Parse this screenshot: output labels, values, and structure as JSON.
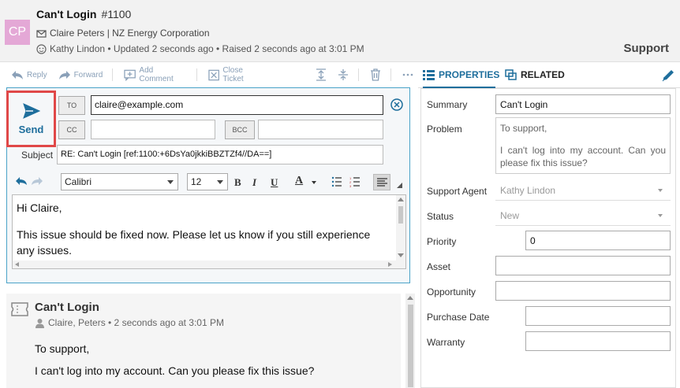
{
  "header": {
    "avatar_initials": "CP",
    "title": "Can't Login",
    "ticket_number": "#1100",
    "contact": "Claire Peters | NZ Energy Corporation",
    "meta": "Kathy Lindon • Updated 2 seconds ago • Raised 2 seconds ago at 3:01 PM",
    "section": "Support"
  },
  "toolbar": {
    "reply": "Reply",
    "forward": "Forward",
    "add_comment": "Add Comment",
    "close_ticket": "Close Ticket"
  },
  "compose": {
    "send": "Send",
    "to_label": "TO",
    "cc_label": "CC",
    "bcc_label": "BCC",
    "to_value": "claire@example.com",
    "subject_label": "Subject",
    "subject_value": "RE: Can't Login [ref:1100:+6DsYa0jkkiBBZTZf4//DA==]",
    "font_family": "Calibri",
    "font_size": "12",
    "body_line1": "Hi Claire,",
    "body_line2": "This issue should be fixed now. Please let us know if you still experience any issues."
  },
  "thread": {
    "title": "Can't Login",
    "meta": "Claire, Peters • 2 seconds ago at 3:01 PM",
    "line1": "To support,",
    "line2": "I can't log into my account. Can you please fix this issue?"
  },
  "panel": {
    "tab_properties": "PROPERTIES",
    "tab_related": "RELATED",
    "summary_label": "Summary",
    "summary_value": "Can't Login",
    "problem_label": "Problem",
    "problem_line1": "To support,",
    "problem_line2": "I can't log into my account. Can you please fix this issue?",
    "agent_label": "Support Agent",
    "agent_value": "Kathy Lindon",
    "status_label": "Status",
    "status_value": "New",
    "priority_label": "Priority",
    "priority_value": "0",
    "asset_label": "Asset",
    "opportunity_label": "Opportunity",
    "purchase_date_label": "Purchase Date",
    "warranty_label": "Warranty"
  },
  "colors": {
    "accent": "#1e6e9c",
    "highlight_border": "#e04848",
    "avatar_bg": "#e4a8d6"
  }
}
